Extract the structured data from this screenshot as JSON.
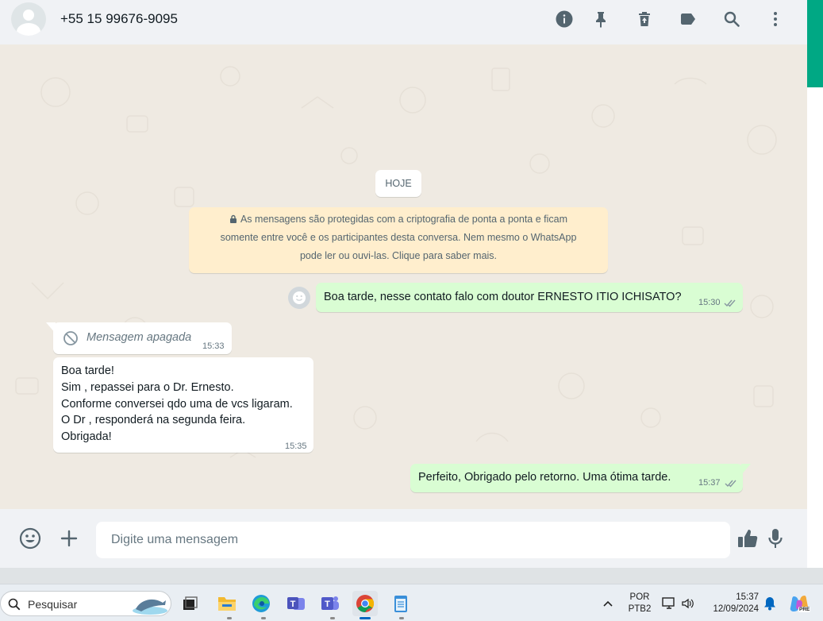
{
  "header": {
    "contact_name": "+55 15 99676-9095",
    "icons": [
      "info-icon",
      "pin-icon",
      "delete-icon",
      "label-icon",
      "search-icon",
      "menu-icon"
    ]
  },
  "chat": {
    "day_chip": "HOJE",
    "encryption_notice": {
      "line1": "As mensagens são protegidas com a criptografia de ponta a ponta e ficam",
      "line2": "somente entre você e os participantes desta conversa. Nem mesmo o WhatsApp",
      "line3": "pode ler ou ouvi-las. Clique para saber mais."
    },
    "messages": [
      {
        "direction": "out",
        "text": "Boa tarde, nesse contato falo com doutor ERNESTO ITIO ICHISATO?",
        "time": "15:30"
      },
      {
        "direction": "in",
        "deleted": true,
        "text": "Mensagem apagada",
        "time": "15:33"
      },
      {
        "direction": "in",
        "lines": [
          "Boa tarde!",
          "Sim , repassei para o Dr. Ernesto.",
          "Conforme conversei qdo uma de vcs ligaram.",
          "O Dr , responderá na segunda feira.",
          "Obrigada!"
        ],
        "time": "15:35"
      },
      {
        "direction": "out",
        "text": "Perfeito, Obrigado pelo retorno. Uma ótima tarde.",
        "time": "15:37"
      }
    ]
  },
  "footer": {
    "input_placeholder": "Digite uma mensagem",
    "input_value": ""
  },
  "taskbar": {
    "search_placeholder": "Pesquisar",
    "language_top": "POR",
    "language_bottom": "PTB2",
    "time": "15:37",
    "date": "12/09/2024",
    "copilot_badge": "PRE"
  },
  "colors": {
    "outgoing_bubble": "#d9fdd3",
    "incoming_bubble": "#ffffff",
    "encryption_bg": "#ffeecd",
    "accent": "#00a884",
    "read_ticks": "#8696a0"
  }
}
